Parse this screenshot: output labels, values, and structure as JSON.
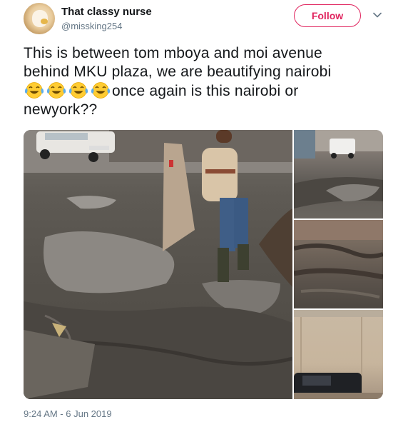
{
  "author": {
    "display_name": "That classy nurse",
    "handle": "@missking254"
  },
  "follow_button": {
    "label": "Follow",
    "color": "#e0245e"
  },
  "menu": {
    "icon": "chevron-down-icon"
  },
  "tweet": {
    "line1": "This is between tom mboya and moi avenue",
    "line2": "behind MKU plaza, we are beautifying nairobi",
    "line3_emojis": [
      "face-with-tears-of-joy",
      "face-with-tears-of-joy",
      "face-with-tears-of-joy",
      "face-with-tears-of-joy"
    ],
    "line3": "once again is this nairobi or",
    "line4": "newyork??"
  },
  "media": {
    "count": 4,
    "main": "muddy-street-photo",
    "thumbs": [
      "flooded-road-photo",
      "mud-closeup-photo",
      "wall-and-car-photo"
    ]
  },
  "timestamp": "9:24 AM - 6 Jun 2019"
}
